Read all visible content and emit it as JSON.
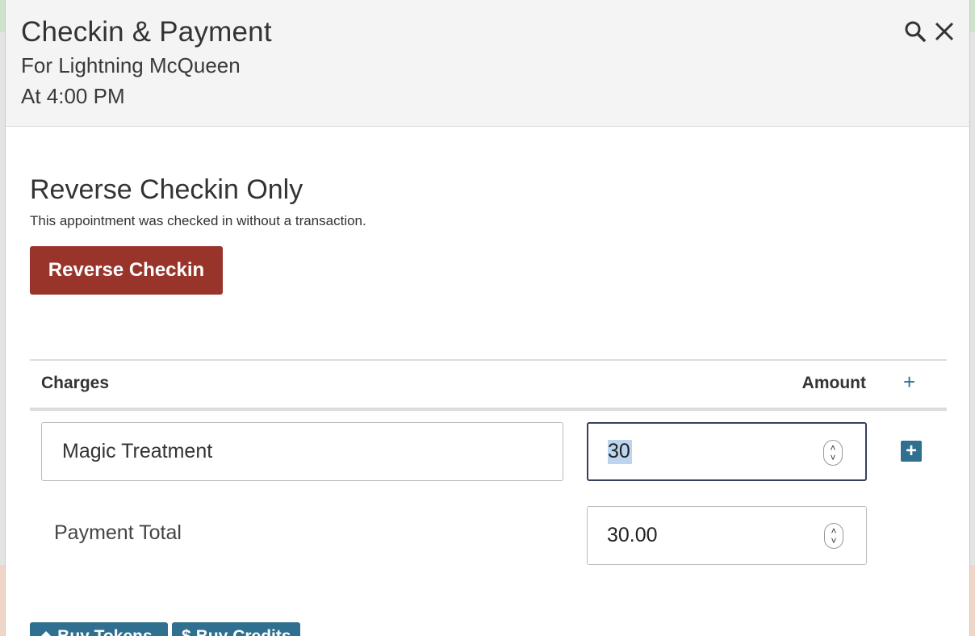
{
  "modal": {
    "title": "Checkin & Payment",
    "subtitle_customer": "For Lightning McQueen",
    "subtitle_time": "At 4:00 PM",
    "icons": {
      "search": "search-icon",
      "close": "close-icon"
    }
  },
  "reverse_section": {
    "title": "Reverse Checkin Only",
    "description": "This appointment was checked in without a transaction.",
    "button_label": "Reverse Checkin",
    "button_color": "#99342b"
  },
  "charges_table": {
    "headers": {
      "charges": "Charges",
      "amount": "Amount",
      "add": "+"
    },
    "rows": [
      {
        "name": "Magic Treatment",
        "amount": "30"
      }
    ],
    "row_add_label": "+"
  },
  "payment_total": {
    "label": "Payment Total",
    "value": "30.00"
  },
  "footer_buttons": [
    {
      "label": "Buy Tokens",
      "icon": "tag-icon"
    },
    {
      "label": "Buy Credits",
      "icon": "dollar-icon"
    }
  ],
  "accent_color": "#2f6f8f"
}
